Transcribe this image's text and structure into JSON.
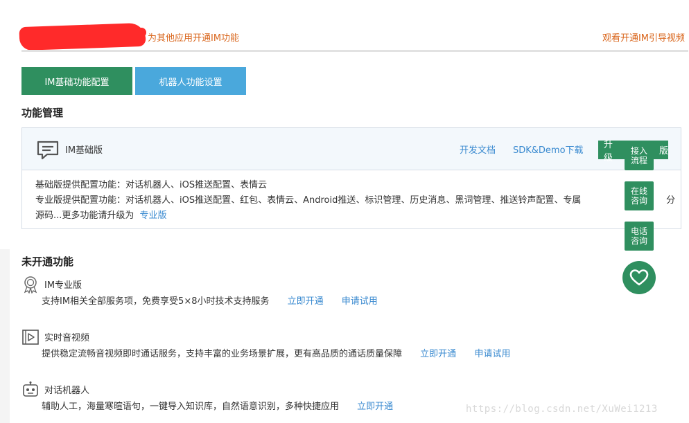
{
  "topbar": {
    "left_text": "为其他应用开通IM功能",
    "right_text": "观看开通IM引导视频"
  },
  "tabs": [
    {
      "label": "IM基础功能配置",
      "active": true
    },
    {
      "label": "机器人功能设置",
      "active": false
    }
  ],
  "section_function": {
    "title": "功能管理"
  },
  "im_card": {
    "title": "IM基础版",
    "doc_link": "开发文档",
    "sdk_link": "SDK&Demo下载",
    "upgrade_button": "升级专业版",
    "upgrade_visible": "升级",
    "upgrade_visible_tail": "版",
    "line1": "基础版提供配置功能：对话机器人、iOS推送配置、表情云",
    "line2": "专业版提供配置功能：对话机器人、iOS推送配置、红包、表情云、Android推送、标识管理、历史消息、黑词管理、推送铃声配置、专属",
    "line2_tail": "分",
    "line3_prefix": "源码...更多功能请升级为",
    "line3_link": "专业版"
  },
  "section_inactive": {
    "title": "未开通功能"
  },
  "features": [
    {
      "icon": "award-icon",
      "title": "IM专业版",
      "desc": "支持IM相关全部服务项，免费享受5×8小时技术支持服务",
      "actions": [
        "立即开通",
        "申请试用"
      ]
    },
    {
      "icon": "video-icon",
      "title": "实时音视频",
      "desc": "提供稳定流畅音视频即时通话服务，支持丰富的业务场景扩展，更有高品质的通话质量保障",
      "actions": [
        "立即开通",
        "申请试用"
      ]
    },
    {
      "icon": "robot-icon",
      "title": "对话机器人",
      "desc": "辅助人工，海量寒暄语句，一键导入知识库，自然语意识别，多种快捷应用",
      "actions": [
        "立即开通"
      ]
    }
  ],
  "float_buttons": [
    {
      "line1": "接入",
      "line2": "流程"
    },
    {
      "line1": "在线",
      "line2": "咨询"
    },
    {
      "line1": "电话",
      "line2": "咨询"
    }
  ],
  "heart_button": {
    "icon": "heart-icon"
  },
  "watermark": "https://blog.csdn.net/XuWei1213",
  "colors": {
    "green": "#2f8f5f",
    "blue": "#4aa8dc",
    "link": "#3a8ad0",
    "orange": "#d9651b"
  }
}
